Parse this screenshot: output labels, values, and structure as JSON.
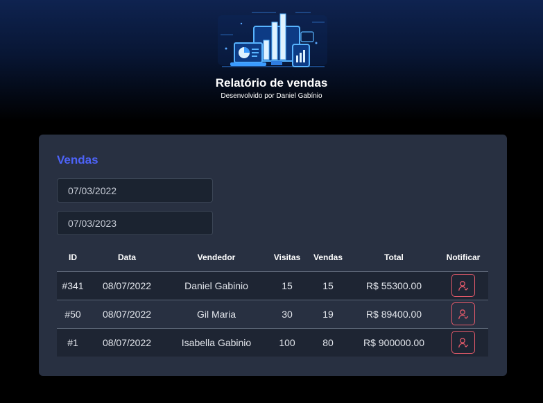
{
  "header": {
    "title": "Relatório de vendas",
    "subtitle": "Desenvolvido por Daniel Gabínio"
  },
  "card": {
    "title": "Vendas",
    "date_from": "07/03/2022",
    "date_to": "07/03/2023"
  },
  "table": {
    "columns": [
      "ID",
      "Data",
      "Vendedor",
      "Visitas",
      "Vendas",
      "Total",
      "Notificar"
    ],
    "rows": [
      {
        "id": "#341",
        "date": "08/07/2022",
        "seller": "Daniel Gabinio",
        "visits": "15",
        "sales": "15",
        "total": "R$ 55300.00"
      },
      {
        "id": "#50",
        "date": "08/07/2022",
        "seller": "Gil Maria",
        "visits": "30",
        "sales": "19",
        "total": "R$ 89400.00"
      },
      {
        "id": "#1",
        "date": "08/07/2022",
        "seller": "Isabella Gabinio",
        "visits": "100",
        "sales": "80",
        "total": "R$ 900000.00"
      }
    ]
  },
  "colors": {
    "accent": "#4d63f8",
    "notify": "#e45a6a",
    "card_bg": "#283041"
  },
  "icons": {
    "logo": "sales-dashboard-illustration",
    "notify": "user-notify-icon"
  }
}
